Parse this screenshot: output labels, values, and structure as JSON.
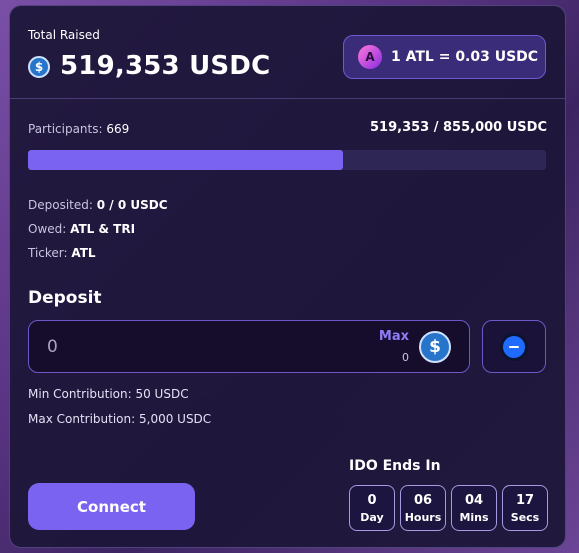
{
  "colors": {
    "accent": "#7b63f2",
    "card_bg": "#1c1638",
    "usdc": "#2775ca"
  },
  "summary": {
    "total_raised_label": "Total Raised",
    "total_raised_value": "519,353 USDC",
    "coin_icon": "usdc-icon"
  },
  "rate": {
    "logo_icon": "atl-logo-icon",
    "text": "1 ATL = 0.03 USDC"
  },
  "progress": {
    "participants_label": "Participants:",
    "participants_count": "669",
    "raised_of_target": "519,353 / 855,000 USDC",
    "fraction": 0.6074
  },
  "info": {
    "deposited_label": "Deposited:",
    "deposited_value": "0 / 0 USDC",
    "owed_label": "Owed:",
    "owed_value": "ATL & TRI",
    "ticker_label": "Ticker:",
    "ticker_value": "ATL"
  },
  "deposit": {
    "title": "Deposit",
    "placeholder": "0",
    "max_label": "Max",
    "max_value": "0",
    "coin_icon": "usdc-icon",
    "token_icon": "token-selector-icon"
  },
  "limits": {
    "min": "Min Contribution: 50 USDC",
    "max": "Max Contribution: 5,000 USDC"
  },
  "countdown": {
    "title": "IDO Ends In",
    "items": [
      {
        "value": "0",
        "unit": "Day"
      },
      {
        "value": "06",
        "unit": "Hours"
      },
      {
        "value": "04",
        "unit": "Mins"
      },
      {
        "value": "17",
        "unit": "Secs"
      }
    ]
  },
  "action": {
    "connect_label": "Connect"
  }
}
